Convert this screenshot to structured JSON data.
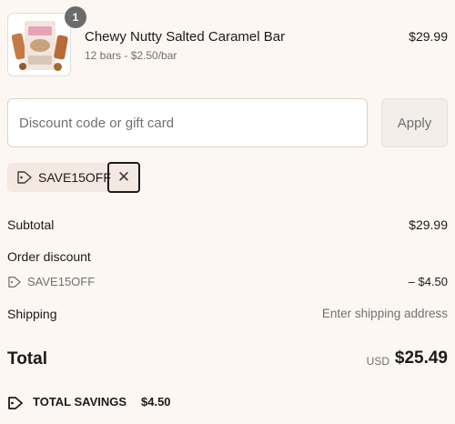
{
  "product": {
    "quantity": "1",
    "name": "Chewy Nutty Salted Caramel Bar",
    "variant": "12 bars - $2.50/bar",
    "price": "$29.99",
    "thumbnail_icon": "product-image"
  },
  "discount": {
    "placeholder": "Discount code or gift card",
    "value": "",
    "apply_label": "Apply"
  },
  "applied_code": {
    "code": "SAVE15OFF",
    "tag_icon": "tag-icon",
    "remove_icon": "close-icon",
    "remove_symbol": "✕"
  },
  "summary": {
    "subtotal_label": "Subtotal",
    "subtotal_value": "$29.99",
    "order_discount_label": "Order discount",
    "order_discount_code": "SAVE15OFF",
    "order_discount_value": "– $4.50",
    "shipping_label": "Shipping",
    "shipping_value": "Enter shipping address",
    "total_label": "Total",
    "total_currency": "USD",
    "total_value": "$25.49",
    "savings_label": "TOTAL SAVINGS",
    "savings_value": "$4.50"
  },
  "colors": {
    "background": "#fdf7f3",
    "chip_background": "#f4e9e2",
    "muted_text": "#707070",
    "badge": "#6b6b6b"
  }
}
